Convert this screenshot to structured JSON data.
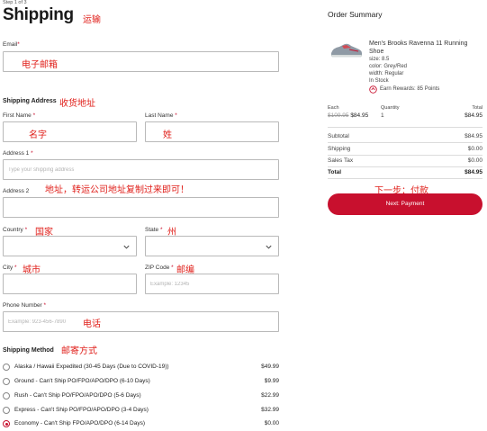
{
  "header": {
    "step": "Step 1 of 3",
    "title": "Shipping",
    "annotation": "运输"
  },
  "email": {
    "label": "Email",
    "required": "*",
    "annotation": "电子邮箱",
    "value": ""
  },
  "shipping_address": {
    "title": "Shipping Address",
    "annotation": "收货地址",
    "first_name": {
      "label": "First Name",
      "required": "*",
      "annotation": "名字"
    },
    "last_name": {
      "label": "Last Name",
      "required": "*",
      "annotation": "姓"
    },
    "address1": {
      "label": "Address 1",
      "required": "*",
      "placeholder": "Type your shipping address"
    },
    "address2": {
      "label": "Address 2",
      "annotation": "地址，转运公司地址复制过来即可！"
    },
    "country": {
      "label": "Country",
      "required": "*",
      "annotation": "国家",
      "value": ""
    },
    "state": {
      "label": "State",
      "required": "*",
      "annotation": "州",
      "value": ""
    },
    "city": {
      "label": "City",
      "required": "*",
      "annotation": "城市"
    },
    "zip": {
      "label": "ZIP Code",
      "required": "*",
      "annotation": "邮编",
      "placeholder": "Example: 12345"
    },
    "phone": {
      "label": "Phone Number",
      "required": "*",
      "annotation": "电话",
      "placeholder": "Example: 923-456-7890"
    }
  },
  "shipping_method": {
    "title": "Shipping Method",
    "annotation": "邮寄方式",
    "options": [
      {
        "name": "Alaska / Hawaii Expedited (30-45 Days (Due to COVID-19))",
        "price": "$49.99",
        "selected": false
      },
      {
        "name": "Ground - Can't Ship PO/FPO/APO/DPO (6-10 Days)",
        "price": "$9.99",
        "selected": false
      },
      {
        "name": "Rush - Can't Ship PO/FPO/APO/DPO (5-6 Days)",
        "price": "$22.99",
        "selected": false
      },
      {
        "name": "Express - Can't Ship PO/FPO/APO/DPO (3-4 Days)",
        "price": "$32.99",
        "selected": false
      },
      {
        "name": "Economy - Can't Ship FPO/APO/DPO (6-14 Days)",
        "price": "$0.00",
        "selected": true
      }
    ]
  },
  "summary": {
    "title": "Order Summary",
    "product": {
      "name": "Men's Brooks Ravenna 11 Running Shoe",
      "size": "size: 8.5",
      "color": "color: Grey/Red",
      "width": "width: Regular",
      "stock": "In Stock",
      "rewards": "Earn Rewards: 85 Points"
    },
    "headers": {
      "each": "Each",
      "quantity": "Quantity",
      "total": "Total"
    },
    "line": {
      "old_price": "$109.95",
      "price": "$84.95",
      "quantity": "1",
      "total": "$84.95"
    },
    "subtotal": {
      "label": "Subtotal",
      "value": "$84.95"
    },
    "shipping": {
      "label": "Shipping",
      "value": "$0.00"
    },
    "tax": {
      "label": "Sales Tax",
      "value": "$0.00"
    },
    "total": {
      "label": "Total",
      "value": "$84.95"
    },
    "next_annotation": "下一步：付款",
    "next_button": "Next: Payment"
  },
  "colors": {
    "brand_red": "#c8102e",
    "annotation_red": "#e0201b",
    "border": "#b9b9b9"
  },
  "icons": [
    "chevron-down-icon",
    "rewards-icon",
    "shoe-image"
  ]
}
